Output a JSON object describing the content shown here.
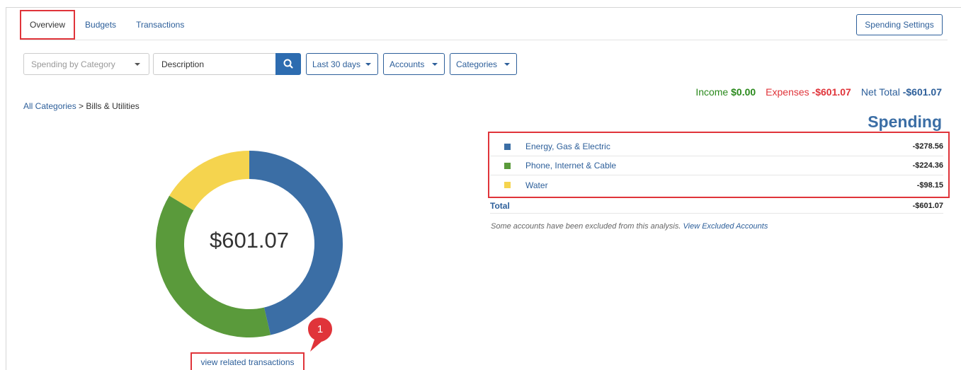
{
  "tabs": [
    {
      "label": "Overview",
      "active": true
    },
    {
      "label": "Budgets",
      "active": false
    },
    {
      "label": "Transactions",
      "active": false
    }
  ],
  "settings_button": "Spending Settings",
  "filters": {
    "view_select": "Spending by Category",
    "description_placeholder": "Description",
    "date_range": "Last 30 days",
    "accounts": "Accounts",
    "categories": "Categories"
  },
  "breadcrumb": {
    "root": "All Categories",
    "separator": ">",
    "current": "Bills & Utilities"
  },
  "totals": {
    "income_label": "Income",
    "income_value": "$0.00",
    "expenses_label": "Expenses",
    "expenses_value": "-$601.07",
    "net_label": "Net Total",
    "net_value": "-$601.07"
  },
  "spending_title": "Spending",
  "legend": [
    {
      "name": "Energy, Gas & Electric",
      "amount": "-$278.56",
      "color": "#3b6ea5"
    },
    {
      "name": "Phone, Internet & Cable",
      "amount": "-$224.36",
      "color": "#5a9a3b"
    },
    {
      "name": "Water",
      "amount": "-$98.15",
      "color": "#f5d44e"
    }
  ],
  "total_row": {
    "label": "Total",
    "amount": "-$601.07"
  },
  "note": {
    "text": "Some accounts have been excluded from this analysis.",
    "link": "View Excluded Accounts"
  },
  "donut": {
    "center_label": "$601.07",
    "values": [
      278.56,
      224.36,
      98.15
    ]
  },
  "related_link": "view related transactions",
  "callout_badge": "1",
  "colors": {
    "accent": "#2d5f9a",
    "highlight": "#e0343a",
    "income": "#2b8a1d"
  }
}
